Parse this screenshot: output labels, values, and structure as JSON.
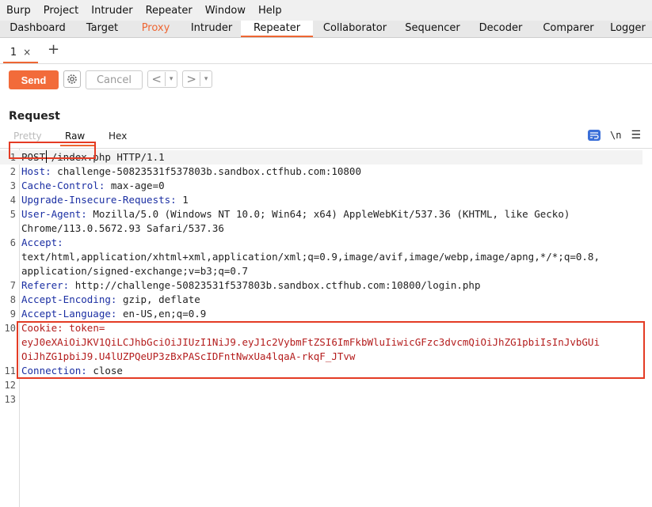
{
  "menu": [
    "Burp",
    "Project",
    "Intruder",
    "Repeater",
    "Window",
    "Help"
  ],
  "main_tabs": [
    "Dashboard",
    "Target",
    "Proxy",
    "Intruder",
    "Repeater",
    "Collaborator",
    "Sequencer",
    "Decoder",
    "Comparer",
    "Logger"
  ],
  "repeater_tab": {
    "label": "1",
    "close": "×"
  },
  "toolbar": {
    "send": "Send",
    "cancel": "Cancel",
    "back": "<",
    "forward": ">",
    "dropdown": "▾"
  },
  "request": {
    "title": "Request",
    "view_tabs": {
      "pretty": "Pretty",
      "raw": "Raw",
      "hex": "Hex"
    },
    "newline_toggle": "\\n",
    "lines": [
      {
        "n": "1",
        "key": "POST /index.php HTTP/1.1",
        "value": ""
      },
      {
        "n": "2",
        "key": "Host:",
        "value": " challenge-50823531f537803b.sandbox.ctfhub.com:10800"
      },
      {
        "n": "3",
        "key": "Cache-Control:",
        "value": " max-age=0"
      },
      {
        "n": "4",
        "key": "Upgrade-Insecure-Requests:",
        "value": " 1"
      },
      {
        "n": "5",
        "key": "User-Agent:",
        "value": " Mozilla/5.0 (Windows NT 10.0; Win64; x64) AppleWebKit/537.36 (KHTML, like Gecko)"
      },
      {
        "n": "",
        "key": "",
        "value": "Chrome/113.0.5672.93 Safari/537.36"
      },
      {
        "n": "6",
        "key": "Accept:",
        "value": ""
      },
      {
        "n": "",
        "key": "",
        "value": "text/html,application/xhtml+xml,application/xml;q=0.9,image/avif,image/webp,image/apng,*/*;q=0.8,"
      },
      {
        "n": "",
        "key": "",
        "value": "application/signed-exchange;v=b3;q=0.7"
      },
      {
        "n": "7",
        "key": "Referer:",
        "value": " http://challenge-50823531f537803b.sandbox.ctfhub.com:10800/login.php"
      },
      {
        "n": "8",
        "key": "Accept-Encoding:",
        "value": " gzip, deflate"
      },
      {
        "n": "9",
        "key": "Accept-Language:",
        "value": " en-US,en;q=0.9"
      },
      {
        "n": "10",
        "key": "Cookie:",
        "value": " token=",
        "cookie": true
      },
      {
        "n": "",
        "key": "",
        "value": "eyJ0eXAiOiJKV1QiLCJhbGciOiJIUzI1NiJ9.eyJ1c2VybmFtZSI6ImFkbWluIiwicGFzc3dvcmQiOiJhZG1pbiIsInJvbGUi",
        "token": true
      },
      {
        "n": "",
        "key": "",
        "value": "OiJhZG1pbiJ9.U4lUZPQeUP3zBxPAScIDFntNwxUa4lqaA-rkqF_JTvw",
        "token": true
      },
      {
        "n": "11",
        "key": "Connection:",
        "value": " close"
      },
      {
        "n": "12",
        "key": "",
        "value": ""
      },
      {
        "n": "13",
        "key": "",
        "value": ""
      }
    ]
  }
}
